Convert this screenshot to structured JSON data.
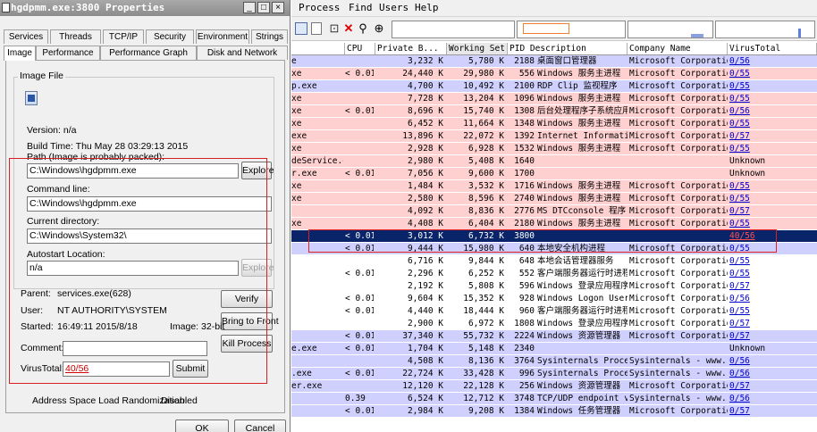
{
  "dialog": {
    "title": "hgdpmm.exe:3800 Properties",
    "caption_buttons": [
      "_",
      "□",
      "×"
    ],
    "tabs_row1": [
      "Services",
      "Threads",
      "TCP/IP",
      "Security",
      "Environment",
      "Strings"
    ],
    "tabs_row2": [
      "Image",
      "Performance",
      "Performance Graph",
      "Disk and Network"
    ],
    "group_title": "Image File",
    "version": "Version:   n/a",
    "build_time": "Build Time:  Thu May 28 03:29:13 2015",
    "path_label": "Path (Image is probably packed):",
    "path_value": "C:\\Windows\\hgdpmm.exe",
    "explore_label": "Explore",
    "cmdline_label": "Command line:",
    "cmdline_value": "C:\\Windows\\hgdpmm.exe",
    "curdir_label": "Current directory:",
    "curdir_value": "C:\\Windows\\System32\\",
    "autostart_label": "Autostart Location:",
    "autostart_value": "n/a",
    "explore2_label": "Explore",
    "parent_label": "Parent:",
    "parent_value": "services.exe(628)",
    "user_label": "User:",
    "user_value": "NT AUTHORITY\\SYSTEM",
    "started_label": "Started:",
    "started_value": "16:49:11  2015/8/18",
    "image_bits": "Image: 32-bit",
    "comment_label": "Comment:",
    "virustotal_label": "VirusTotal:",
    "virustotal_value": "40/56",
    "verify_btn": "Verify",
    "bring_front_btn": "Bring to Front",
    "kill_btn": "Kill Process",
    "submit_btn": "Submit",
    "aslr_label": "Address Space Load Randomization:",
    "aslr_value": "Disabled",
    "ok_btn": "OK",
    "cancel_btn": "Cancel"
  },
  "procexp": {
    "menu": [
      "Process",
      "Find",
      "Users",
      "Help"
    ],
    "columns": [
      "CPU",
      "Private B...",
      "Working Set",
      "PID",
      "Description",
      "Company Name",
      "VirusTotal"
    ],
    "rows": [
      {
        "name": "e",
        "cpu": "",
        "priv": "3,232 K",
        "ws": "5,780 K",
        "pid": "2188",
        "desc": "桌面窗口管理器",
        "company": "Microsoft Corporation",
        "vt": "0/56",
        "bg": "#d0d0ff"
      },
      {
        "name": "xe",
        "cpu": "< 0.01",
        "priv": "24,440 K",
        "ws": "29,980 K",
        "pid": "556",
        "desc": "Windows 服务主进程",
        "company": "Microsoft Corporation",
        "vt": "0/55",
        "bg": "#ffd0d0"
      },
      {
        "name": "p.exe",
        "cpu": "",
        "priv": "4,700 K",
        "ws": "10,492 K",
        "pid": "2100",
        "desc": "RDP Clip 监视程序",
        "company": "Microsoft Corporation",
        "vt": "0/55",
        "bg": "#d0d0ff"
      },
      {
        "name": "xe",
        "cpu": "",
        "priv": "7,728 K",
        "ws": "13,204 K",
        "pid": "1096",
        "desc": "Windows 服务主进程",
        "company": "Microsoft Corporation",
        "vt": "0/55",
        "bg": "#ffd0d0"
      },
      {
        "name": "xe",
        "cpu": "< 0.01",
        "priv": "8,696 K",
        "ws": "15,740 K",
        "pid": "1308",
        "desc": "后台处理程序子系统应用程序",
        "company": "Microsoft Corporation",
        "vt": "0/56",
        "bg": "#ffd0d0"
      },
      {
        "name": "xe",
        "cpu": "",
        "priv": "6,452 K",
        "ws": "11,664 K",
        "pid": "1348",
        "desc": "Windows 服务主进程",
        "company": "Microsoft Corporation",
        "vt": "0/55",
        "bg": "#ffd0d0"
      },
      {
        "name": "exe",
        "cpu": "",
        "priv": "13,896 K",
        "ws": "22,072 K",
        "pid": "1392",
        "desc": "Internet Information ...",
        "company": "Microsoft Corporation",
        "vt": "0/57",
        "bg": "#ffd0d0"
      },
      {
        "name": "xe",
        "cpu": "",
        "priv": "2,928 K",
        "ws": "6,928 K",
        "pid": "1532",
        "desc": "Windows 服务主进程",
        "company": "Microsoft Corporation",
        "vt": "0/55",
        "bg": "#ffd0d0"
      },
      {
        "name": "deService.exe",
        "cpu": "",
        "priv": "2,980 K",
        "ws": "5,408 K",
        "pid": "1640",
        "desc": "",
        "company": "",
        "vt": "Unknown",
        "bg": "#ffd0d0"
      },
      {
        "name": "r.exe",
        "cpu": "< 0.01",
        "priv": "7,056 K",
        "ws": "9,600 K",
        "pid": "1700",
        "desc": "",
        "company": "",
        "vt": "Unknown",
        "bg": "#ffd0d0"
      },
      {
        "name": "xe",
        "cpu": "",
        "priv": "1,484 K",
        "ws": "3,532 K",
        "pid": "1716",
        "desc": "Windows 服务主进程",
        "company": "Microsoft Corporation",
        "vt": "0/55",
        "bg": "#ffd0d0"
      },
      {
        "name": "xe",
        "cpu": "",
        "priv": "2,580 K",
        "ws": "8,596 K",
        "pid": "2740",
        "desc": "Windows 服务主进程",
        "company": "Microsoft Corporation",
        "vt": "0/55",
        "bg": "#ffd0d0"
      },
      {
        "name": "",
        "cpu": "",
        "priv": "4,092 K",
        "ws": "8,836 K",
        "pid": "2776",
        "desc": "MS DTCconsole 程序",
        "company": "Microsoft Corporation",
        "vt": "0/57",
        "bg": "#ffd0d0"
      },
      {
        "name": "xe",
        "cpu": "",
        "priv": "4,408 K",
        "ws": "6,404 K",
        "pid": "2180",
        "desc": "Windows 服务主进程",
        "company": "Microsoft Corporation",
        "vt": "0/55",
        "bg": "#ffd0d0"
      },
      {
        "name": "",
        "cpu": "< 0.01",
        "priv": "3,012 K",
        "ws": "6,732 K",
        "pid": "3800",
        "desc": "",
        "company": "",
        "vt": "40/56",
        "bg": "#0a246a",
        "sel": true
      },
      {
        "name": "",
        "cpu": "< 0.01",
        "priv": "9,444 K",
        "ws": "15,980 K",
        "pid": "640",
        "desc": "本地安全机构进程",
        "company": "Microsoft Corporation",
        "vt": "0/55",
        "bg": "#d0d0ff"
      },
      {
        "name": "",
        "cpu": "",
        "priv": "6,716 K",
        "ws": "9,844 K",
        "pid": "648",
        "desc": "本地会话管理器服务",
        "company": "Microsoft Corporation",
        "vt": "0/55",
        "bg": "#fff"
      },
      {
        "name": "",
        "cpu": "< 0.01",
        "priv": "2,296 K",
        "ws": "6,252 K",
        "pid": "552",
        "desc": "客户端服务器运行时进程",
        "company": "Microsoft Corporation",
        "vt": "0/55",
        "bg": "#fff"
      },
      {
        "name": "",
        "cpu": "",
        "priv": "2,192 K",
        "ws": "5,808 K",
        "pid": "596",
        "desc": "Windows 登录应用程序",
        "company": "Microsoft Corporation",
        "vt": "0/57",
        "bg": "#fff"
      },
      {
        "name": "",
        "cpu": "< 0.01",
        "priv": "9,604 K",
        "ws": "15,352 K",
        "pid": "928",
        "desc": "Windows Logon User In...",
        "company": "Microsoft Corporation",
        "vt": "0/56",
        "bg": "#fff"
      },
      {
        "name": "",
        "cpu": "< 0.01",
        "priv": "4,440 K",
        "ws": "18,444 K",
        "pid": "960",
        "desc": "客户端服务器运行时进程",
        "company": "Microsoft Corporation",
        "vt": "0/55",
        "bg": "#fff"
      },
      {
        "name": "",
        "cpu": "",
        "priv": "2,900 K",
        "ws": "6,972 K",
        "pid": "1808",
        "desc": "Windows 登录应用程序",
        "company": "Microsoft Corporation",
        "vt": "0/57",
        "bg": "#fff"
      },
      {
        "name": "",
        "cpu": "< 0.01",
        "priv": "37,340 K",
        "ws": "55,732 K",
        "pid": "2224",
        "desc": "Windows 资源管理器",
        "company": "Microsoft Corporation",
        "vt": "0/57",
        "bg": "#d0d0ff"
      },
      {
        "name": "e.exe",
        "cpu": "< 0.01",
        "priv": "1,704 K",
        "ws": "5,148 K",
        "pid": "2340",
        "desc": "",
        "company": "",
        "vt": "Unknown",
        "bg": "#d0d0ff"
      },
      {
        "name": "",
        "cpu": "",
        "priv": "4,508 K",
        "ws": "8,136 K",
        "pid": "3764",
        "desc": "Sysinternals Process ...",
        "company": "Sysinternals - www....",
        "vt": "0/56",
        "bg": "#d0d0ff"
      },
      {
        "name": ".exe",
        "cpu": "< 0.01",
        "priv": "22,724 K",
        "ws": "33,428 K",
        "pid": "996",
        "desc": "Sysinternals Process ...",
        "company": "Sysinternals - www....",
        "vt": "0/56",
        "bg": "#d0d0ff"
      },
      {
        "name": "er.exe",
        "cpu": "",
        "priv": "12,120 K",
        "ws": "22,128 K",
        "pid": "256",
        "desc": "Windows 资源管理器",
        "company": "Microsoft Corporation",
        "vt": "0/57",
        "bg": "#d0d0ff"
      },
      {
        "name": "",
        "cpu": "0.39",
        "priv": "6,524 K",
        "ws": "12,712 K",
        "pid": "3748",
        "desc": "TCP/UDP endpoint viewer",
        "company": "Sysinternals - www....",
        "vt": "0/56",
        "bg": "#d0d0ff"
      },
      {
        "name": "",
        "cpu": "< 0.01",
        "priv": "2,984 K",
        "ws": "9,208 K",
        "pid": "1384",
        "desc": "Windows 任务管理器",
        "company": "Microsoft Corporation",
        "vt": "0/57",
        "bg": "#d0d0ff"
      }
    ]
  },
  "colors": {
    "service_row": "#ffd0d0",
    "own_process_row": "#d0d0ff",
    "selected_row": "#0a246a",
    "malicious_vt": "#cc0000"
  }
}
